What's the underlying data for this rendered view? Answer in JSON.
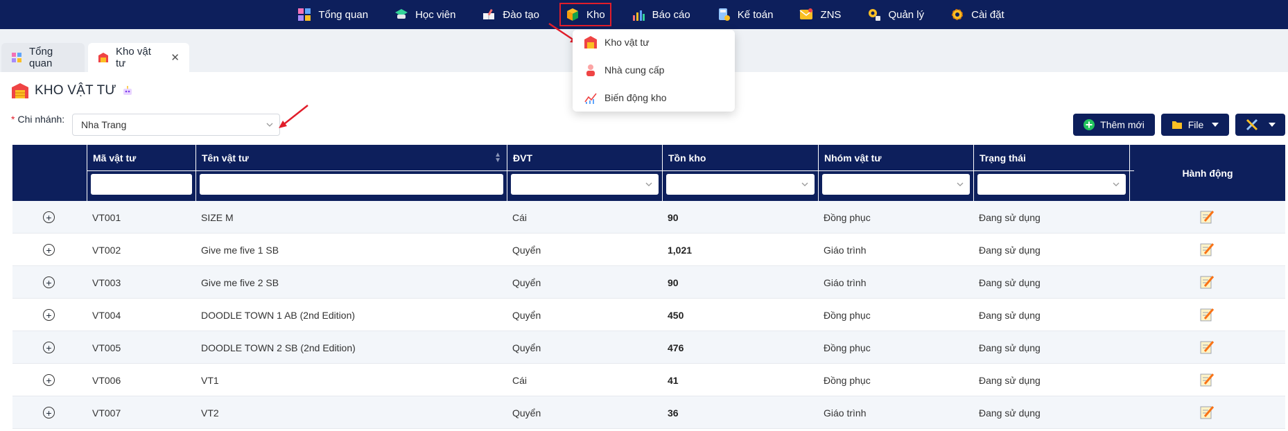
{
  "nav": {
    "items": [
      {
        "label": "Tổng quan",
        "icon": "dashboard-icon"
      },
      {
        "label": "Học viên",
        "icon": "graduation-cap-icon"
      },
      {
        "label": "Đào tạo",
        "icon": "book-icon"
      },
      {
        "label": "Kho",
        "icon": "box-icon"
      },
      {
        "label": "Báo cáo",
        "icon": "bar-chart-icon"
      },
      {
        "label": "Kế toán",
        "icon": "calculator-icon"
      },
      {
        "label": "ZNS",
        "icon": "message-icon"
      },
      {
        "label": "Quản lý",
        "icon": "manage-icon"
      },
      {
        "label": "Cài đặt",
        "icon": "gear-icon"
      }
    ],
    "active": "Kho"
  },
  "dropdown": {
    "items": [
      {
        "label": "Kho vật tư",
        "icon": "warehouse-icon"
      },
      {
        "label": "Nhà cung cấp",
        "icon": "supplier-icon"
      },
      {
        "label": "Biến động kho",
        "icon": "line-chart-icon"
      }
    ]
  },
  "tabs": [
    {
      "label": "Tổng quan",
      "active": false
    },
    {
      "label": "Kho vật tư",
      "active": true
    }
  ],
  "page": {
    "title": "KHO VẬT TƯ",
    "branch_label": "Chi nhánh:",
    "branch_value": "Nha Trang"
  },
  "toolbar": {
    "add_label": "Thêm mới",
    "file_label": "File"
  },
  "table": {
    "columns": [
      "Mã vật tư",
      "Tên vật tư",
      "ĐVT",
      "Tồn kho",
      "Nhóm vật tư",
      "Trạng thái"
    ],
    "action_header": "Hành động",
    "rows": [
      {
        "code": "VT001",
        "name": "SIZE M",
        "unit": "Cái",
        "stock": "90",
        "group": "Đồng phục",
        "status": "Đang sử dụng"
      },
      {
        "code": "VT002",
        "name": "Give me five 1 SB",
        "unit": "Quyển",
        "stock": "1,021",
        "group": "Giáo trình",
        "status": "Đang sử dụng"
      },
      {
        "code": "VT003",
        "name": "Give me five 2 SB",
        "unit": "Quyển",
        "stock": "90",
        "group": "Giáo trình",
        "status": "Đang sử dụng"
      },
      {
        "code": "VT004",
        "name": "DOODLE TOWN 1 AB (2nd Edition)",
        "unit": "Quyển",
        "stock": "450",
        "group": "Đồng phục",
        "status": "Đang sử dụng"
      },
      {
        "code": "VT005",
        "name": "DOODLE TOWN 2 SB (2nd Edition)",
        "unit": "Quyển",
        "stock": "476",
        "group": "Đồng phục",
        "status": "Đang sử dụng"
      },
      {
        "code": "VT006",
        "name": "VT1",
        "unit": "Cái",
        "stock": "41",
        "group": "Đồng phục",
        "status": "Đang sử dụng"
      },
      {
        "code": "VT007",
        "name": "VT2",
        "unit": "Quyển",
        "stock": "36",
        "group": "Giáo trình",
        "status": "Đang sử dụng"
      }
    ]
  },
  "colors": {
    "navy": "#0d1f5c",
    "highlight": "#e11d2a"
  }
}
